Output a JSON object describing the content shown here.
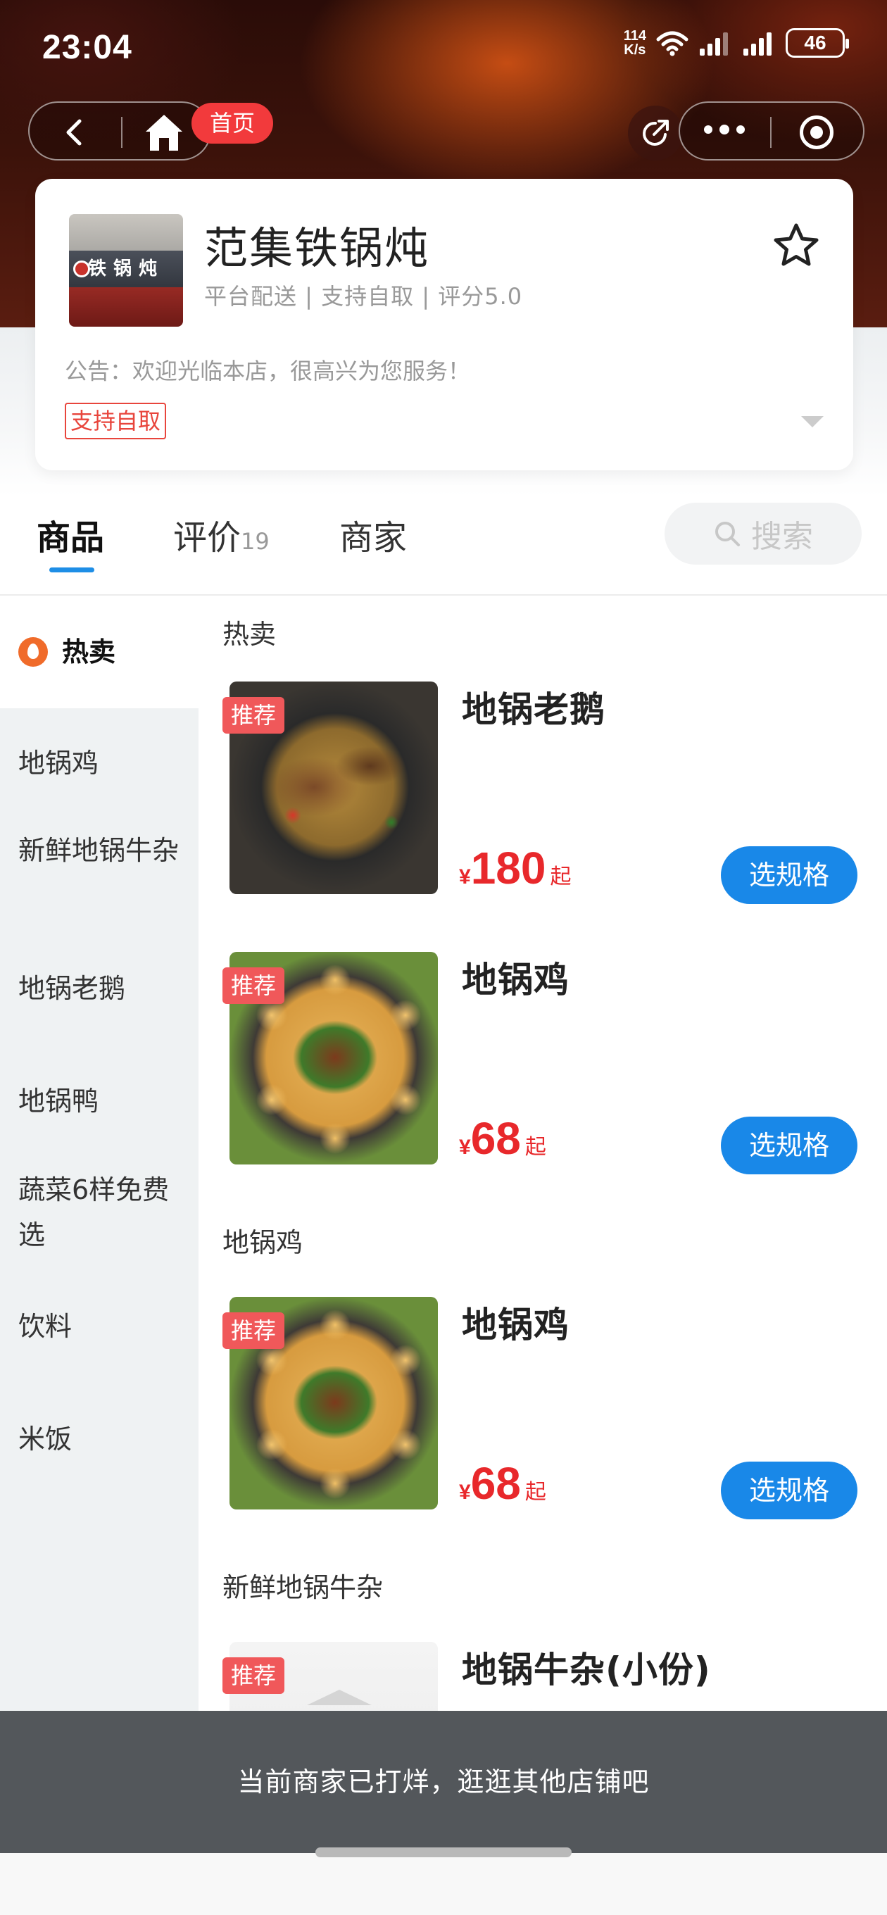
{
  "status_bar": {
    "time": "23:04",
    "net_speed_value": "114",
    "net_speed_unit": "K/s",
    "battery": "46"
  },
  "nav": {
    "home_badge": "首页"
  },
  "shop": {
    "name": "范集铁锅炖",
    "logo_text": "铁锅炖",
    "meta": "平台配送 | 支持自取 | 评分5.0",
    "notice": "公告：欢迎光临本店，很高兴为您服务！",
    "pickup_tag": "支持自取"
  },
  "tabs": {
    "items": [
      {
        "label": "商品"
      },
      {
        "label": "评价",
        "count": "19"
      },
      {
        "label": "商家"
      }
    ],
    "search_label": "搜索"
  },
  "sidebar": {
    "items": [
      {
        "label": "热卖"
      },
      {
        "label": "地锅鸡"
      },
      {
        "label": "新鲜地锅牛杂"
      },
      {
        "label": "地锅老鹅"
      },
      {
        "label": "地锅鸭"
      },
      {
        "label": "蔬菜6样免费选"
      },
      {
        "label": "饮料"
      },
      {
        "label": "米饭"
      }
    ]
  },
  "sections": [
    {
      "title": "热卖"
    },
    {
      "title": "地锅鸡"
    },
    {
      "title": "新鲜地锅牛杂"
    }
  ],
  "products": [
    {
      "name": "地锅老鹅",
      "badge": "推荐",
      "currency": "¥",
      "price": "180",
      "suffix": "起",
      "button": "选规格"
    },
    {
      "name": "地锅鸡",
      "badge": "推荐",
      "currency": "¥",
      "price": "68",
      "suffix": "起",
      "button": "选规格"
    },
    {
      "name": "地锅鸡",
      "badge": "推荐",
      "currency": "¥",
      "price": "68",
      "suffix": "起",
      "button": "选规格"
    },
    {
      "name": "地锅牛杂(小份)",
      "badge": "推荐"
    }
  ],
  "closed_message": "当前商家已打烊，逛逛其他店铺吧",
  "colors": {
    "accent_blue": "#1988e8",
    "price_red": "#e8282b",
    "badge_red": "#f0585a",
    "closed_bar": "#53575b"
  }
}
